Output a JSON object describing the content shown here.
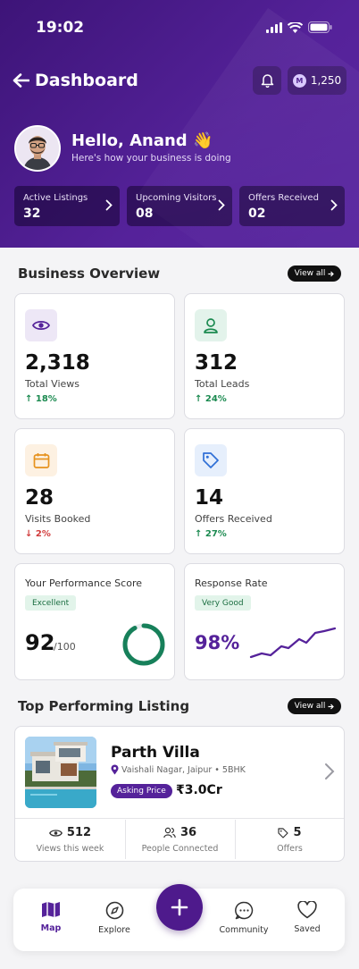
{
  "status_bar": {
    "time": "19:02"
  },
  "header": {
    "title": "Dashboard",
    "coins": "1,250",
    "coin_symbol": "M"
  },
  "greeting": {
    "hello": "Hello, Anand 👋",
    "subtitle": "Here's how your business is doing"
  },
  "stat_pills": [
    {
      "label": "Active Listings",
      "value": "32"
    },
    {
      "label": "Upcoming Visitors",
      "value": "08"
    },
    {
      "label": "Offers Received",
      "value": "02"
    }
  ],
  "business_overview": {
    "title": "Business Overview",
    "view_all": "View all",
    "metrics": [
      {
        "value": "2,318",
        "label": "Total Views",
        "change": "18%",
        "direction": "up",
        "icon": "eye-icon"
      },
      {
        "value": "312",
        "label": "Total Leads",
        "change": "24%",
        "direction": "up",
        "icon": "user-icon"
      },
      {
        "value": "28",
        "label": "Visits Booked",
        "change": "2%",
        "direction": "down",
        "icon": "calendar-icon"
      },
      {
        "value": "14",
        "label": "Offers Received",
        "change": "27%",
        "direction": "up",
        "icon": "tag-icon"
      }
    ],
    "performance": {
      "title": "Your Performance Score",
      "tag": "Excellent",
      "score": "92",
      "out_of": "/100",
      "fraction": 0.92
    },
    "response": {
      "title": "Response Rate",
      "tag": "Very Good",
      "value": "98%"
    }
  },
  "top_listing": {
    "title": "Top Performing Listing",
    "view_all": "View all",
    "name": "Parth Villa",
    "location": "Vaishali Nagar, Jaipur • 5BHK",
    "badge": "Asking Price",
    "price": "₹3.0Cr",
    "stats": [
      {
        "value": "512",
        "label": "Views this week",
        "icon": "eye-icon"
      },
      {
        "value": "36",
        "label": "People Connected",
        "icon": "people-icon"
      },
      {
        "value": "5",
        "label": "Offers",
        "icon": "tag-icon"
      }
    ]
  },
  "tab_bar": {
    "items": [
      {
        "label": "Map",
        "icon": "map-icon",
        "active": true
      },
      {
        "label": "Explore",
        "icon": "compass-icon",
        "active": false
      },
      {
        "label": "Community",
        "icon": "chat-icon",
        "active": false
      },
      {
        "label": "Saved",
        "icon": "heart-icon",
        "active": false
      }
    ],
    "fab_icon": "plus-icon"
  },
  "colors": {
    "brand": "#55229a",
    "up": "#1b8a50",
    "down": "#d13b3b",
    "ring": "#17805a"
  }
}
